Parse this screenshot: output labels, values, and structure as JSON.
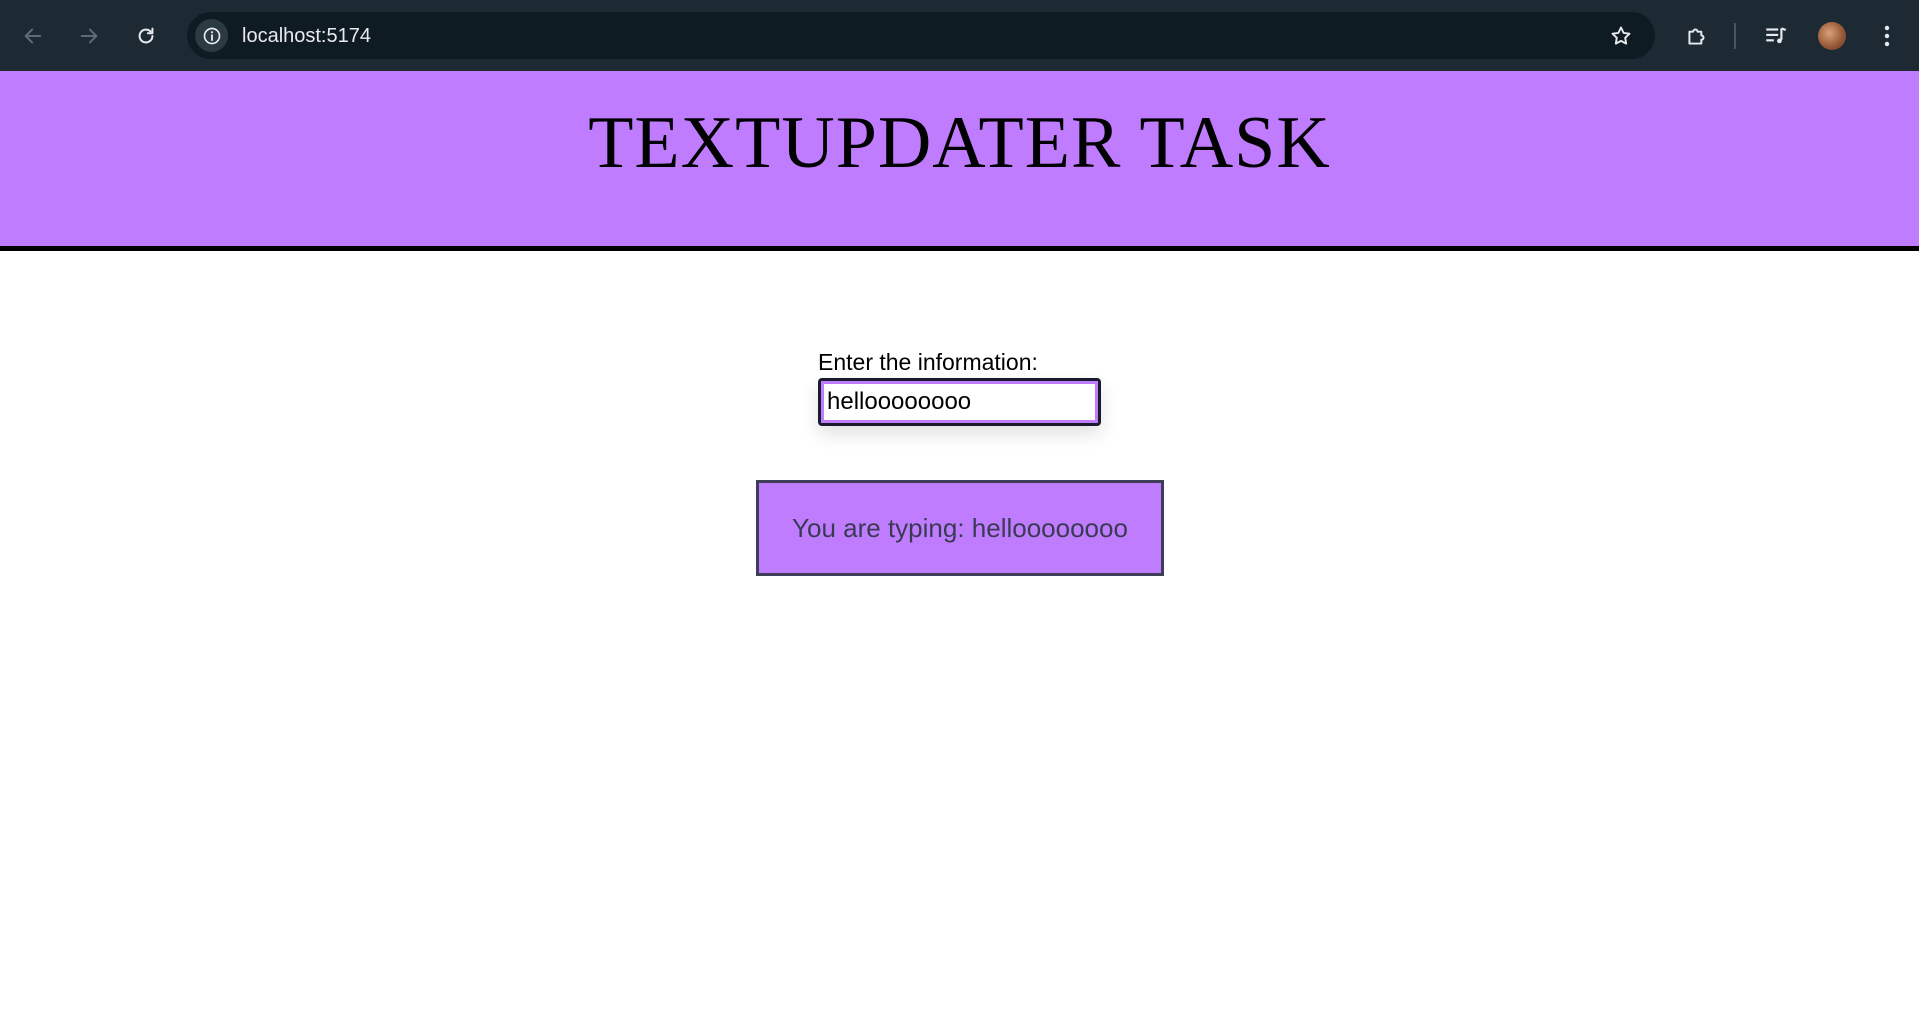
{
  "browser": {
    "url": "localhost:5174",
    "icons": {
      "back": "arrow-left-icon",
      "forward": "arrow-right-icon",
      "reload": "reload-icon",
      "site_info": "info-icon",
      "bookmark": "star-icon",
      "extensions": "puzzle-icon",
      "media": "media-queue-icon",
      "profile": "avatar",
      "menu": "kebab-menu-icon"
    }
  },
  "page": {
    "title": "TEXTUPDATER TASK",
    "input_label": "Enter the information:",
    "input_value": "helloooooooo",
    "output_text": "You are typing: helloooooooo"
  },
  "colors": {
    "accent": "#c07cff",
    "chrome_bg": "#1e2a33",
    "omnibox_bg": "#0f1b22"
  }
}
